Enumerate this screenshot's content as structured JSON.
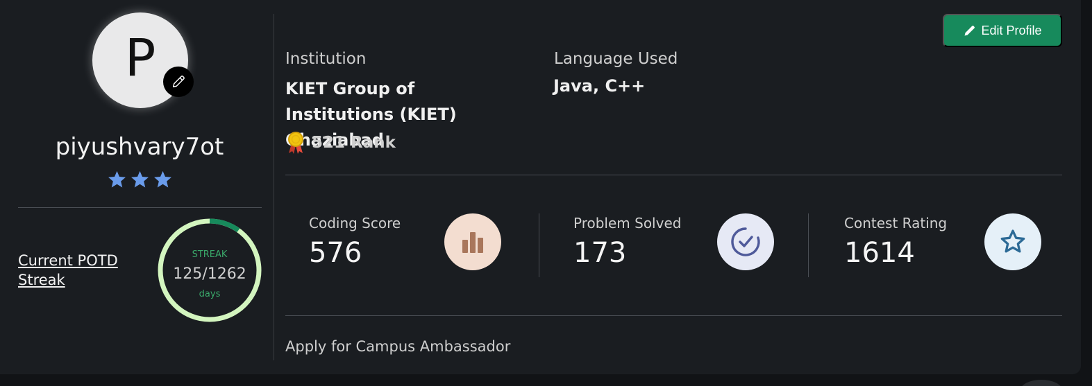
{
  "profile": {
    "avatar_letter": "P",
    "username": "piyushvary7ot",
    "stars": 3,
    "potd_link": "Current POTD Streak",
    "streak": {
      "label": "STREAK",
      "current": "125",
      "total": "/1262",
      "text": "125/1262",
      "unit": "days",
      "progress": 0.099
    }
  },
  "header": {
    "edit_button": "Edit Profile"
  },
  "info": {
    "institution_label": "Institution",
    "institution_value": "KIET Group of Institutions (KIET) Ghaziabad",
    "language_label": "Language Used",
    "language_value": "Java, C++",
    "rank_text": "521 Rank"
  },
  "stats": [
    {
      "label": "Coding Score",
      "value": "576",
      "icon": "bar-chart-icon",
      "icon_bg": "#f3ddd0",
      "icon_color": "#a9765b"
    },
    {
      "label": "Problem Solved",
      "value": "173",
      "icon": "check-circle-icon",
      "icon_bg": "#e6e9f5",
      "icon_color": "#4f5a9a"
    },
    {
      "label": "Contest Rating",
      "value": "1614",
      "icon": "star-icon",
      "icon_bg": "#e5f0f8",
      "icon_color": "#2c6a96"
    }
  ],
  "footer": {
    "ambassador_link": "Apply for Campus Ambassador"
  },
  "colors": {
    "accent_green": "#178a5c",
    "star_blue": "#6a9ceb",
    "ring_light": "#d3f5bf",
    "ring_dark": "#178a5c"
  }
}
